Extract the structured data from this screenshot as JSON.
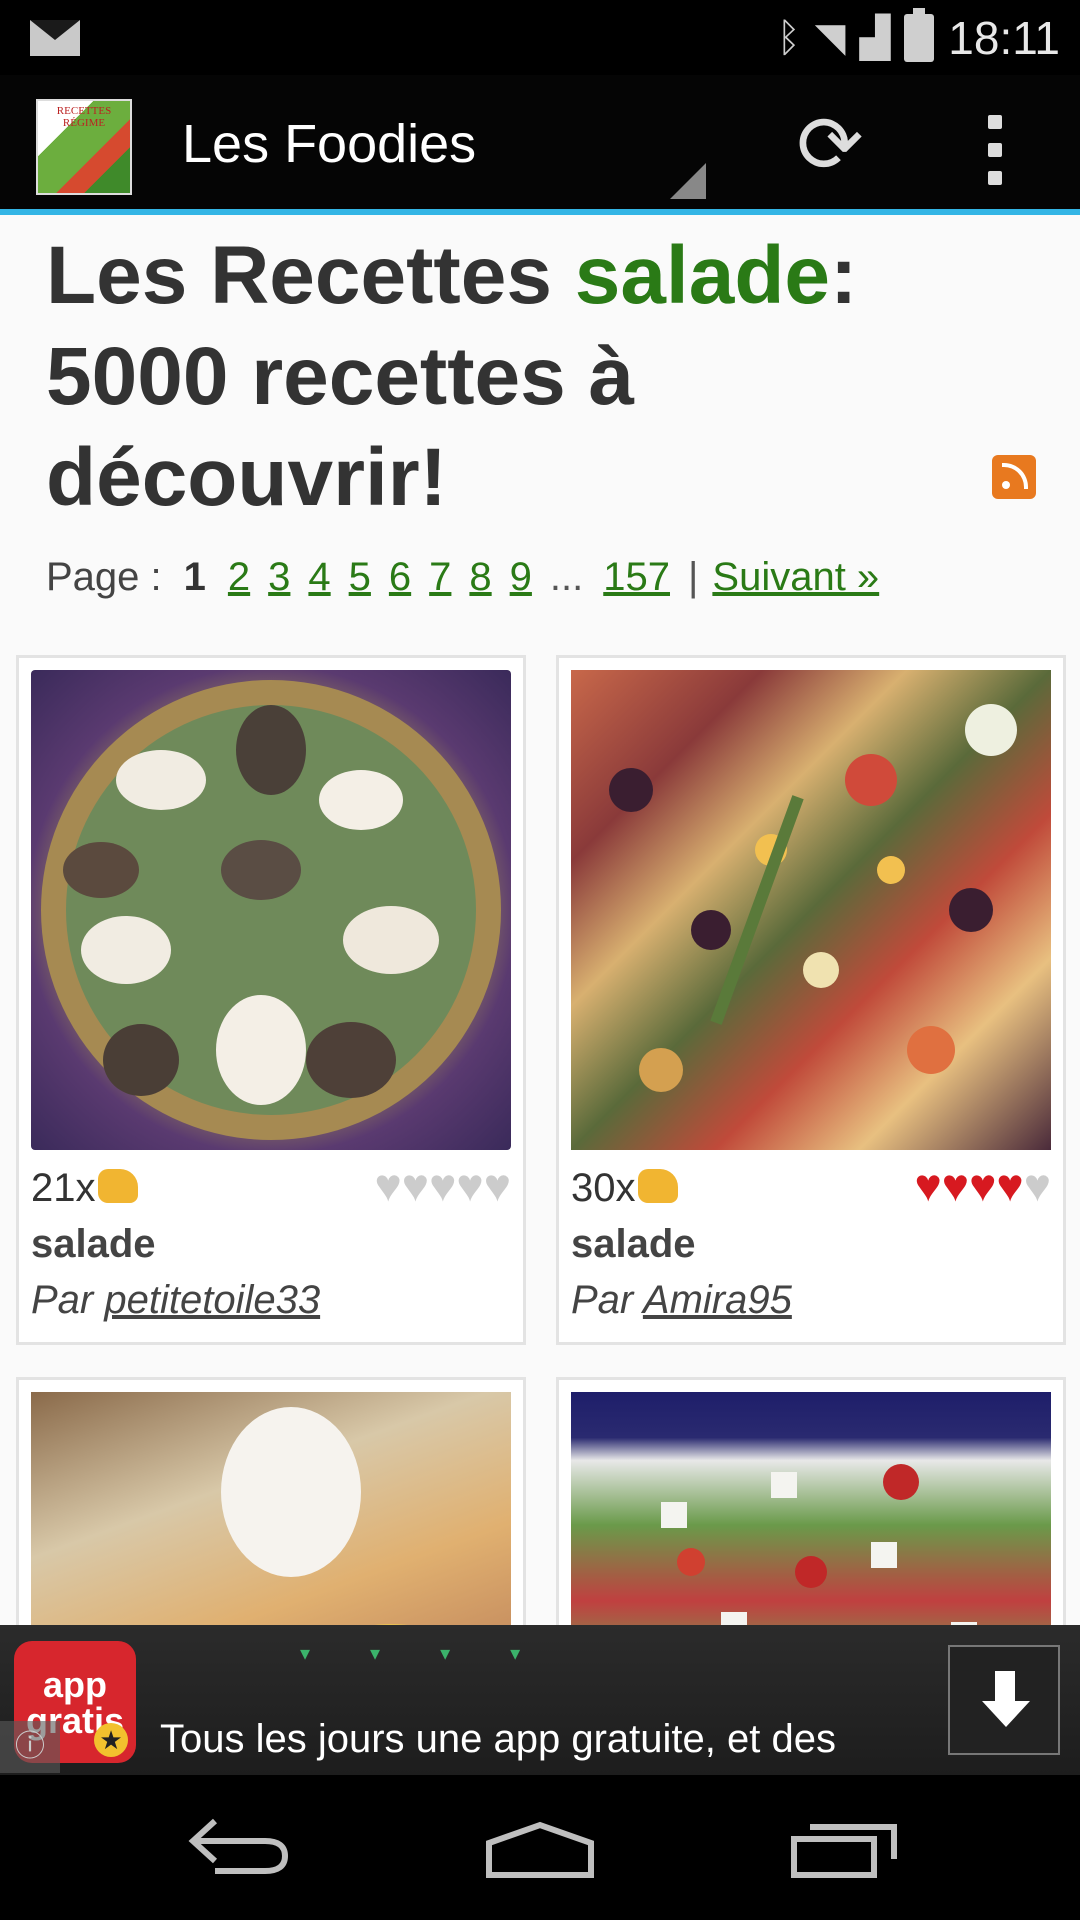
{
  "status_bar": {
    "time": "18:11"
  },
  "action_bar": {
    "app_title": "Les Foodies",
    "logo_text": "RECETTES RÉGIME"
  },
  "page": {
    "headline_part1": "Les Recettes ",
    "headline_accent": "salade",
    "headline_part2": ": 5000 recettes à découvrir!",
    "pager": {
      "label": "Page :",
      "current": "1",
      "pages": [
        "2",
        "3",
        "4",
        "5",
        "6",
        "7",
        "8",
        "9"
      ],
      "ellipsis": "...",
      "last": "157",
      "separator": "|",
      "next": "Suivant »"
    }
  },
  "recipes": [
    {
      "votes": "21x",
      "title": "salade",
      "author_prefix": "Par",
      "author": "petitetoile33",
      "rating": 0
    },
    {
      "votes": "30x",
      "title": "salade",
      "author_prefix": "Par",
      "author": "Amira95",
      "rating": 4
    }
  ],
  "ad": {
    "logo_text": "app gratis",
    "text": "Tous les jours une app gratuite, et des"
  },
  "colors": {
    "accent_green": "#2a7a16",
    "holo_blue": "#33b5e5",
    "heart_red": "#d71920"
  }
}
